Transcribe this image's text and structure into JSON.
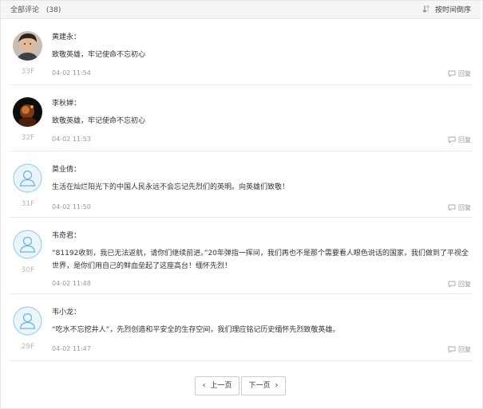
{
  "header": {
    "title": "全部评论",
    "count": "(38)",
    "sort_label": "按时间倒序"
  },
  "comments": [
    {
      "name": "黄建永：",
      "text": "致敬英雄，牢记使命不忘初心",
      "floor": "33F",
      "time": "04-02 11:54",
      "reply": "回复",
      "avatar": "photo-avatar"
    },
    {
      "name": "李秋婵：",
      "text": "致敬英雄，牢记使命不忘初心",
      "floor": "32F",
      "time": "04-02 11:53",
      "reply": "回复",
      "avatar": "photo-avatar-dark"
    },
    {
      "name": "莫业倩：",
      "text": "生活在灿烂阳光下的中国人民永远不会忘记先烈们的英明。向英雄们致敬！",
      "floor": "31F",
      "time": "04-02 11:50",
      "reply": "回复",
      "avatar": "default-user-avatar"
    },
    {
      "name": "韦奇君：",
      "text": "“81192收到，我已无法返航，请你们继续前进。”20年弹指一挥间，我们再也不是那个需要看人眼色说话的国家，我们做到了平视全世界，是你们用自己的鲜血垒起了这座高台！缅怀先烈！",
      "floor": "30F",
      "time": "04-02 11:48",
      "reply": "回复",
      "avatar": "default-user-avatar"
    },
    {
      "name": "韦小龙：",
      "text": "“吃水不忘挖井人”，先烈创造和平安全的生存空间，我们理应铭记历史缅怀先烈致敬英雄。",
      "floor": "29F",
      "time": "04-02 11:47",
      "reply": "回复",
      "avatar": "default-user-avatar"
    }
  ],
  "pagination": {
    "prev_label": "上一页",
    "next_label": "下一页"
  },
  "colors": {
    "avatar_ring": "#9fd0e8",
    "avatar_fill": "#e9f5fb",
    "avatar_icon": "#6db6dc"
  }
}
